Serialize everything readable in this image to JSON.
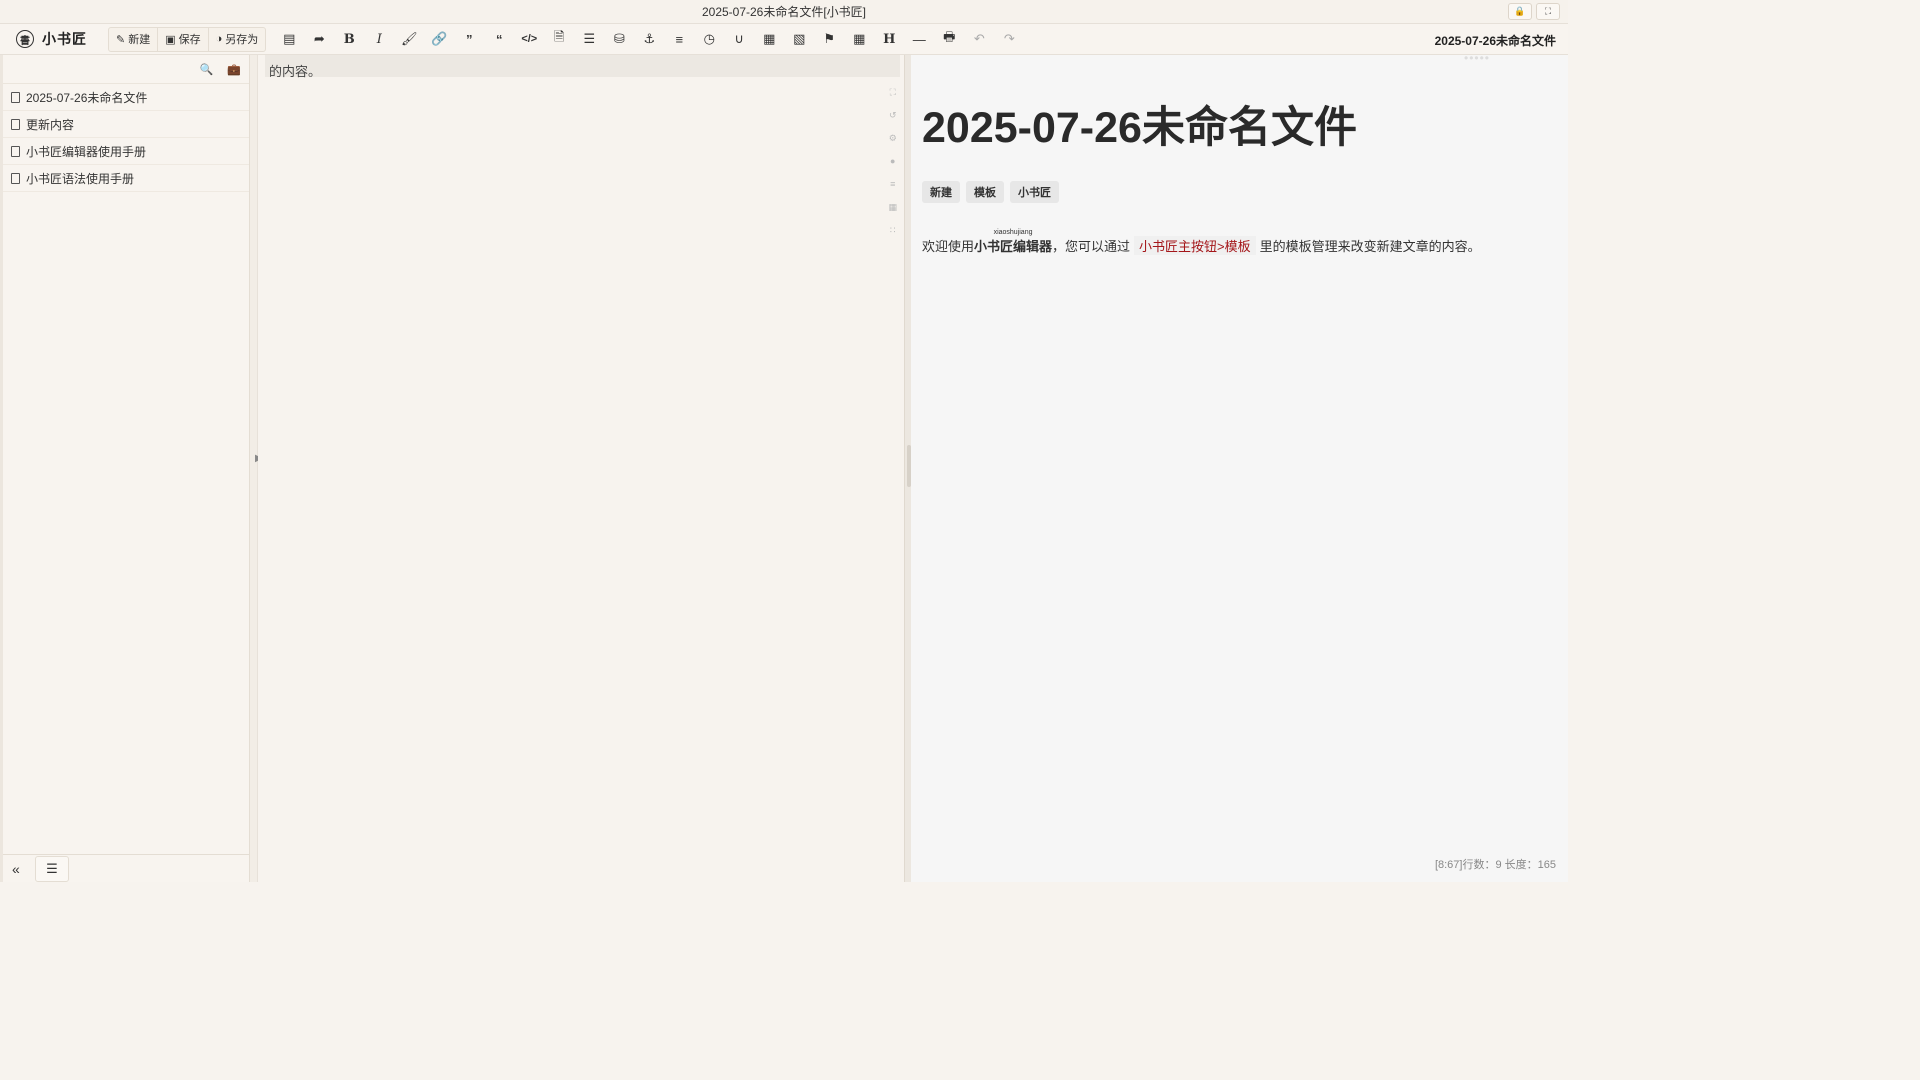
{
  "window": {
    "title": "2025-07-26未命名文件[小书匠]",
    "lock_icon": "lock-icon",
    "fullscreen_icon": "fullscreen-icon"
  },
  "toolbar": {
    "logo_text": "小书匠",
    "new_label": "新建",
    "save_label": "保存",
    "save_as_label": "另存为",
    "icons": [
      "card-icon",
      "redo-arrow-icon",
      "bold-icon",
      "italic-icon",
      "brush-icon",
      "link-icon",
      "quote-icon",
      "blockquote-icon",
      "code-icon",
      "file-code-icon",
      "list-icon",
      "shield-icon",
      "anchor-icon",
      "align-icon",
      "clock-icon",
      "magnet-icon",
      "table-edit-icon",
      "table-edit2-icon",
      "flag-icon",
      "table-icon",
      "heading-icon",
      "hr-icon",
      "print-doc-icon",
      "undo-icon",
      "redo-icon"
    ],
    "doc_name": "2025-07-26未命名文件"
  },
  "sidebar": {
    "files": [
      {
        "name": "2025-07-26未命名文件"
      },
      {
        "name": "更新内容"
      },
      {
        "name": "小书匠编辑器使用手册"
      },
      {
        "name": "小书匠语法使用手册"
      }
    ]
  },
  "editor": {
    "visible_line": "的内容。"
  },
  "preview": {
    "title": "2025-07-26未命名文件",
    "tags": [
      "新建",
      "模板",
      "小书匠"
    ],
    "para_prefix": "欢迎使用",
    "ruby_text": "xiaoshujiang",
    "ruby_base": "小书匠编辑器",
    "para_middle": "，您可以通过",
    "code_text": "小书匠主按钮>模板",
    "para_suffix": "里的模板管理来改变新建文章的内容。",
    "status": "[8:67]行数：9 长度：165"
  }
}
